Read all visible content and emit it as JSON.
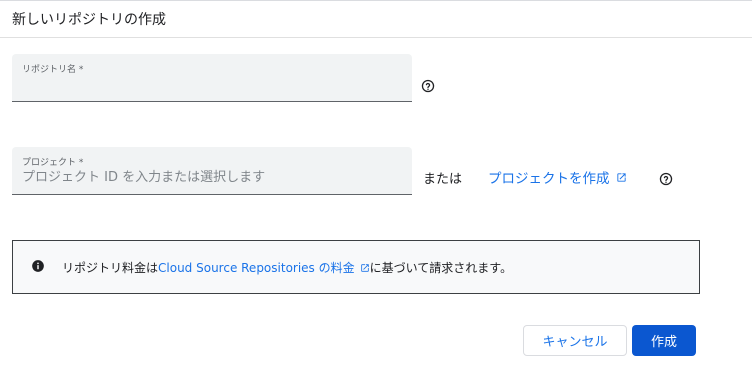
{
  "dialog": {
    "title": "新しいリポジトリの作成"
  },
  "repo_name_field": {
    "label": "リポジトリ名 *",
    "value": "",
    "help_icon": "help-circle-icon"
  },
  "project_field": {
    "label": "プロジェクト *",
    "value": "",
    "placeholder": "プロジェクト ID を入力または選択します",
    "or_text": "または",
    "create_link": "プロジェクトを作成",
    "link_icon": "open-in-new-icon",
    "help_icon": "help-circle-icon"
  },
  "info": {
    "icon": "info-icon",
    "text_before": "リポジトリ料金は ",
    "link_text": "Cloud Source Repositories の料金",
    "link_icon": "open-in-new-icon",
    "text_after": "に基づいて請求されます。"
  },
  "buttons": {
    "cancel": "キャンセル",
    "create": "作成"
  },
  "colors": {
    "accent": "#1a73e8",
    "primary_button": "#0b57d0",
    "field_background": "#f1f3f4",
    "info_background": "#f8f9fa"
  }
}
